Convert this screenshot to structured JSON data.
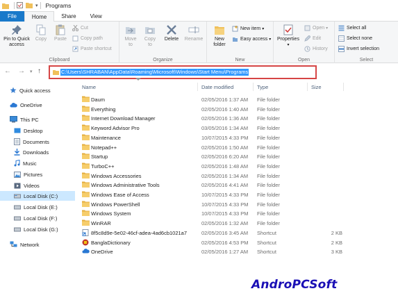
{
  "window": {
    "title": "Programs"
  },
  "tabs": [
    {
      "label": "File"
    },
    {
      "label": "Home"
    },
    {
      "label": "Share"
    },
    {
      "label": "View"
    }
  ],
  "ribbon": {
    "clipboard": {
      "label": "Clipboard",
      "pin": "Pin to Quick access",
      "pin_l1": "Pin to Quick",
      "pin_l2": "access",
      "copy": "Copy",
      "paste": "Paste",
      "cut": "Cut",
      "copy_path": "Copy path",
      "paste_shortcut": "Paste shortcut"
    },
    "organize": {
      "label": "Organize",
      "move_l1": "Move",
      "move_l2": "to",
      "copy_l1": "Copy",
      "copy_l2": "to",
      "delete": "Delete",
      "rename": "Rename"
    },
    "new": {
      "label": "New",
      "new_folder_l1": "New",
      "new_folder_l2": "folder",
      "new_item": "New item",
      "easy_access": "Easy access"
    },
    "open": {
      "label": "Open",
      "properties": "Properties",
      "open": "Open",
      "edit": "Edit",
      "history": "History"
    },
    "select": {
      "label": "Select",
      "select_all": "Select all",
      "select_none": "Select none",
      "invert": "Invert selection"
    }
  },
  "address": {
    "path": "C:\\Users\\SHRABAN\\AppData\\Roaming\\Microsoft\\Windows\\Start Menu\\Programs"
  },
  "columns": {
    "name": "Name",
    "date": "Date modified",
    "type": "Type",
    "size": "Size"
  },
  "sidebar": [
    {
      "label": "Quick access",
      "icon": "star-icon"
    },
    {
      "label": "OneDrive",
      "icon": "cloud-icon"
    },
    {
      "label": "This PC",
      "icon": "computer-icon"
    },
    {
      "label": "Desktop",
      "icon": "desktop-icon"
    },
    {
      "label": "Documents",
      "icon": "documents-icon"
    },
    {
      "label": "Downloads",
      "icon": "download-icon"
    },
    {
      "label": "Music",
      "icon": "music-icon"
    },
    {
      "label": "Pictures",
      "icon": "pictures-icon"
    },
    {
      "label": "Videos",
      "icon": "videos-icon"
    },
    {
      "label": "Local Disk (C:)",
      "icon": "drive-icon"
    },
    {
      "label": "Local Disk (E:)",
      "icon": "drive-icon"
    },
    {
      "label": "Local Disk (F:)",
      "icon": "drive-icon"
    },
    {
      "label": "Local Disk (G:)",
      "icon": "drive-icon"
    },
    {
      "label": "Network",
      "icon": "network-icon"
    }
  ],
  "files": [
    {
      "name": "Daum",
      "date": "02/05/2016 1:37 AM",
      "type": "File folder",
      "size": "",
      "icon": "folder-icon"
    },
    {
      "name": "Everything",
      "date": "02/05/2016 1:40 AM",
      "type": "File folder",
      "size": "",
      "icon": "folder-icon"
    },
    {
      "name": "Internet Download Manager",
      "date": "02/05/2016 1:36 AM",
      "type": "File folder",
      "size": "",
      "icon": "folder-icon"
    },
    {
      "name": "Keyword Advisor Pro",
      "date": "03/05/2016 1:34 AM",
      "type": "File folder",
      "size": "",
      "icon": "folder-icon"
    },
    {
      "name": "Maintenance",
      "date": "10/07/2015 4:33 PM",
      "type": "File folder",
      "size": "",
      "icon": "folder-icon"
    },
    {
      "name": "Notepad++",
      "date": "02/05/2016 1:50 AM",
      "type": "File folder",
      "size": "",
      "icon": "folder-icon"
    },
    {
      "name": "Startup",
      "date": "02/05/2016 6:20 AM",
      "type": "File folder",
      "size": "",
      "icon": "folder-icon"
    },
    {
      "name": "TurboC++",
      "date": "02/05/2016 1:48 AM",
      "type": "File folder",
      "size": "",
      "icon": "folder-icon"
    },
    {
      "name": "Windows Accessories",
      "date": "02/05/2016 1:34 AM",
      "type": "File folder",
      "size": "",
      "icon": "folder-icon"
    },
    {
      "name": "Windows Administrative Tools",
      "date": "02/05/2016 4:41 AM",
      "type": "File folder",
      "size": "",
      "icon": "folder-icon"
    },
    {
      "name": "Windows Ease of Access",
      "date": "10/07/2015 4:33 PM",
      "type": "File folder",
      "size": "",
      "icon": "folder-icon"
    },
    {
      "name": "Windows PowerShell",
      "date": "10/07/2015 4:33 PM",
      "type": "File folder",
      "size": "",
      "icon": "folder-icon"
    },
    {
      "name": "Windows System",
      "date": "10/07/2015 4:33 PM",
      "type": "File folder",
      "size": "",
      "icon": "folder-icon"
    },
    {
      "name": "WinRAR",
      "date": "02/05/2016 1:32 AM",
      "type": "File folder",
      "size": "",
      "icon": "folder-icon"
    },
    {
      "name": "8f5c8d9e-5e02-46cf-adea-4ad6cb1021a7",
      "date": "02/05/2016 3:45 AM",
      "type": "Shortcut",
      "size": "2 KB",
      "icon": "shortcut-icon"
    },
    {
      "name": "BanglaDictionary",
      "date": "02/05/2016 4:53 PM",
      "type": "Shortcut",
      "size": "2 KB",
      "icon": "dictionary-icon"
    },
    {
      "name": "OneDrive",
      "date": "02/05/2016 1:27 AM",
      "type": "Shortcut",
      "size": "3 KB",
      "icon": "cloud-icon"
    }
  ],
  "watermark": "AndroPCSoft",
  "colors": {
    "accent": "#1979ca",
    "selection": "#cce8ff",
    "folder": "#f0c05a",
    "highlight_box": "#d64545"
  }
}
